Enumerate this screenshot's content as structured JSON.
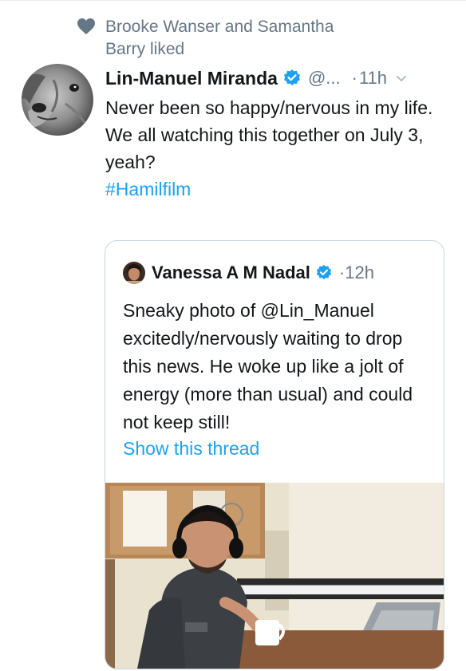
{
  "social_context": {
    "text": "Brooke Wanser and Samantha Barry liked"
  },
  "tweet": {
    "display_name": "Lin-Manuel Miranda",
    "handle": "@...",
    "separator": "·",
    "time": "11h",
    "lines": [
      "Never been so happy/nervous in my life.",
      "We all watching this together on July 3, yeah?"
    ],
    "hashtag": "#Hamilfilm"
  },
  "quoted_tweet": {
    "display_name": "Vanessa A M Nadal",
    "time": "·12h",
    "text": "Sneaky photo of @Lin_Manuel excitedly/nervously waiting to drop this news. He woke up like a jolt of energy (more than usual) and could not keep still!",
    "show_thread": "Show this thread"
  },
  "colors": {
    "link": "#1da1f2",
    "secondary_text": "#657786",
    "verified": "#1da1f2",
    "border": "#ccd6dd"
  },
  "icons": {
    "like": "heart-icon",
    "verified": "verified-badge-icon",
    "menu": "chevron-down-icon"
  }
}
